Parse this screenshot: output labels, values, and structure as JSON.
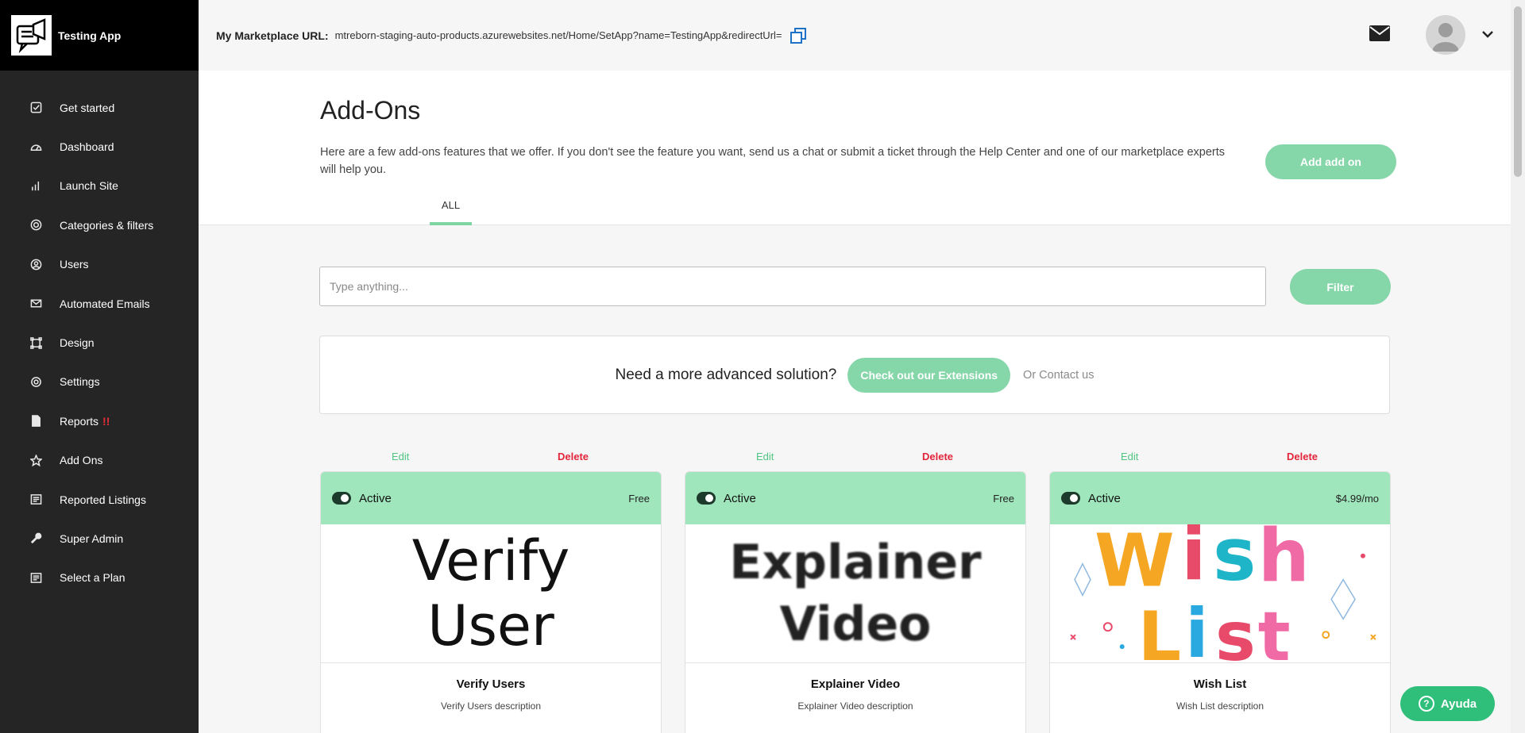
{
  "app": {
    "name": "Testing App"
  },
  "sidebar": {
    "items": [
      {
        "label": "Get started",
        "icon": "check-square-icon"
      },
      {
        "label": "Dashboard",
        "icon": "gauge-icon"
      },
      {
        "label": "Launch Site",
        "icon": "bar-chart-icon"
      },
      {
        "label": "Categories & filters",
        "icon": "target-icon"
      },
      {
        "label": "Users",
        "icon": "user-circle-icon"
      },
      {
        "label": "Automated Emails",
        "icon": "envelope-icon"
      },
      {
        "label": "Design",
        "icon": "vector-square-icon"
      },
      {
        "label": "Settings",
        "icon": "gear-icon"
      },
      {
        "label": "Reports",
        "icon": "document-icon",
        "alert": "!!"
      },
      {
        "label": "Add Ons",
        "icon": "star-icon"
      },
      {
        "label": "Reported Listings",
        "icon": "list-icon"
      },
      {
        "label": "Super Admin",
        "icon": "wrench-icon"
      },
      {
        "label": "Select a Plan",
        "icon": "list-icon"
      }
    ]
  },
  "topbar": {
    "url_label": "My Marketplace URL:",
    "url_value": "mtreborn-staging-auto-products.azurewebsites.net/Home/SetApp?name=TestingApp&redirectUrl="
  },
  "header": {
    "title": "Add-Ons",
    "description": "Here are a few add-ons features that we offer. If you don't see the feature you want, send us a chat or submit a ticket through the Help Center and one of our marketplace experts will help you.",
    "add_button": "Add add on",
    "tab": "ALL"
  },
  "search": {
    "placeholder": "Type anything...",
    "filter_button": "Filter"
  },
  "promo": {
    "text": "Need a more advanced solution?",
    "button": "Check out our Extensions",
    "contact": "Or Contact us"
  },
  "cards": [
    {
      "edit": "Edit",
      "delete": "Delete",
      "status": "Active",
      "price": "Free",
      "image_text": [
        "Verify",
        "User"
      ],
      "title": "Verify Users",
      "description": "Verify Users description"
    },
    {
      "edit": "Edit",
      "delete": "Delete",
      "status": "Active",
      "price": "Free",
      "image_text": [
        "Explainer",
        "Video"
      ],
      "title": "Explainer Video",
      "description": "Explainer Video description"
    },
    {
      "edit": "Edit",
      "delete": "Delete",
      "status": "Active",
      "price": "$4.99/mo",
      "image_text": [
        "Wish",
        "List"
      ],
      "title": "Wish List",
      "description": "Wish List description"
    }
  ],
  "help": {
    "label": "Ayuda"
  },
  "colors": {
    "accent": "#85d6a8",
    "sidebar": "#252525",
    "danger": "#e2253a",
    "card_header": "#9fe6bc"
  }
}
